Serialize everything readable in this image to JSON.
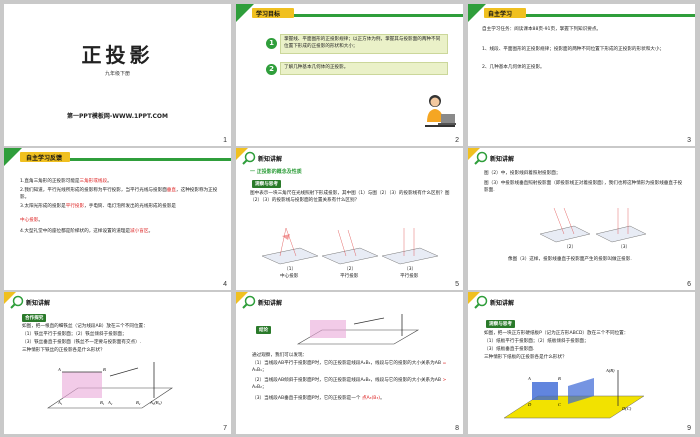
{
  "slides": [
    {
      "num": "1",
      "title": "正投影",
      "subtitle": "九年级下册",
      "footer": "第一PPT模板网-WWW.1PPT.COM"
    },
    {
      "num": "2",
      "header": "学习目标",
      "steps": [
        {
          "n": "1",
          "text": "掌握线、平面图形的正投影规律；以正方体为例，掌握其与投影面的两种不同位置下形成的正投影的形状和大小；"
        },
        {
          "n": "2",
          "text": "了解几种基本几何体的正投影。"
        }
      ]
    },
    {
      "num": "3",
      "header": "自主学习",
      "lines": [
        "自主学习任务：阅读课本88页-91页，掌握下列知识要点。",
        "1、线段、平面图形的正投影规律；投影面的两种不同位置下形成的正投影的形状和大小；",
        "2、几种基本几何体的正投影。"
      ]
    },
    {
      "num": "4",
      "header": "自主学习反馈",
      "lines": [
        {
          "pre": "1.直角三角形的正投影可能是",
          "ans": "三角形或线段",
          "post": "。"
        },
        {
          "pre": "2.我们知道，平行光线所形成的投影称为平行投影，当平行光线与投影面",
          "ans": "垂直",
          "post": "，这种投影称为正投影。"
        },
        {
          "pre": "3.太阳光形成的投影是",
          "ans": "平行投影",
          "post": "，手电筒、电灯泡所发出的光线形成的投影是"
        },
        {
          "pre": "",
          "ans": "中心投影",
          "post": "。"
        },
        {
          "pre": "4.大型礼堂中的座位都是阶梯状的，这样设置的道理是",
          "ans": "减小盲区",
          "post": "。"
        }
      ]
    },
    {
      "num": "5",
      "header": "新知讲解",
      "section": "一 正投影的概念及性质",
      "tag": "观察与思考",
      "text": "图中表示一块三角尺在光线照射下形成投影，其中图（1）与图（2）（3）的投影线有什么区别？图（2）（3）的投影线与投影面的位置关系有什么区别？",
      "captions": [
        {
          "label": "（1）",
          "desc": "中心投影"
        },
        {
          "label": "（2）",
          "desc": "平行投影"
        },
        {
          "label": "（3）",
          "desc": "平行投影"
        }
      ]
    },
    {
      "num": "6",
      "header": "新知讲解",
      "text1": "图（2）中，投影线斜着照射投影面；",
      "text2": "图（3）中投影线垂直照射投影面（即投影线正对着投影面），我们也称这种情形为投影线垂直于投影面.",
      "captions": [
        "（2）",
        "（3）"
      ],
      "text3": "像图（3）这样，投影线垂直于投影面产生的投影叫做正投影."
    },
    {
      "num": "7",
      "header": "新知讲解",
      "tag": "合作探究",
      "lines": [
        "如图，把一根直的细铁丝（记为线段AB）放在三个不同位置：",
        "（1）铁丝平行于投影面；（2）铁丝倾斜于投影面；",
        "（3）铁丝垂直于投影面（铁丝不一定要与投影面有交点）.",
        "三种情形下铁丝的正投影各是什么形状？"
      ],
      "points": [
        "A",
        "B",
        "A₁",
        "B₁",
        "A₂",
        "B₂",
        "A₃(B₃)"
      ]
    },
    {
      "num": "8",
      "header": "新知讲解",
      "tag": "结论",
      "lines": [
        "通过观察，我们可以发现：",
        "（1）当线段AB平行于投影面P时，它的正投影是线段A₁B₁，线段与它的投影的大小关系为AB",
        "（2）当线段AB倾斜于投影面P时，它的正投影是线段A₂B₂，线段与它的投影的大小关系为AB",
        "（3）当线段AB垂直于投影面P时，它的正投影是一个"
      ],
      "answers": [
        "=",
        ">",
        "点A₃(B₃)"
      ],
      "suffix": [
        "A₁B₁；",
        "A₂B₂；",
        "。"
      ]
    },
    {
      "num": "9",
      "header": "新知讲解",
      "tag": "观察与思考",
      "lines": [
        "如图，把一块正方形硬纸板P（记为正方形ABCD）放在三个不同位置：",
        "（1）纸板平行于投影面；（2）纸板倾斜于投影面；",
        "（3）纸板垂直于投影面.",
        "三种情形下纸板的正投影各是什么形状？"
      ],
      "points": [
        "A",
        "B",
        "C",
        "D",
        "A(B)",
        "D(C)"
      ]
    }
  ],
  "colors": {
    "green": "#2f9e3b",
    "yellow": "#f0c020",
    "red": "#dd2222"
  }
}
